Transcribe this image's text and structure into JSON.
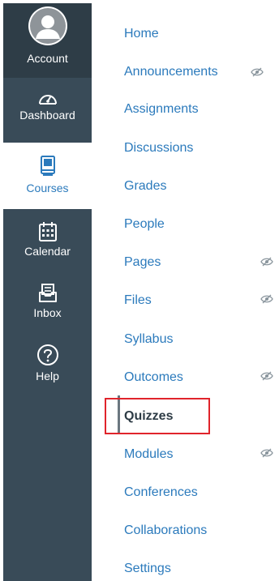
{
  "global_nav": {
    "account": {
      "label": "Account",
      "icon": "avatar-icon"
    },
    "dashboard": {
      "label": "Dashboard",
      "icon": "dashboard-gauge-icon"
    },
    "courses": {
      "label": "Courses",
      "icon": "courses-book-icon",
      "active": true
    },
    "calendar": {
      "label": "Calendar",
      "icon": "calendar-icon"
    },
    "inbox": {
      "label": "Inbox",
      "icon": "inbox-icon"
    },
    "help": {
      "label": "Help",
      "icon": "help-question-icon"
    }
  },
  "course_nav": {
    "items": [
      {
        "label": "Home",
        "hidden": false
      },
      {
        "label": "Announcements",
        "hidden": true
      },
      {
        "label": "Assignments",
        "hidden": false
      },
      {
        "label": "Discussions",
        "hidden": false
      },
      {
        "label": "Grades",
        "hidden": false
      },
      {
        "label": "People",
        "hidden": false
      },
      {
        "label": "Pages",
        "hidden": true
      },
      {
        "label": "Files",
        "hidden": true
      },
      {
        "label": "Syllabus",
        "hidden": false
      },
      {
        "label": "Outcomes",
        "hidden": true
      },
      {
        "label": "Quizzes",
        "hidden": false,
        "active": true,
        "highlighted": true
      },
      {
        "label": "Modules",
        "hidden": true
      },
      {
        "label": "Conferences",
        "hidden": false
      },
      {
        "label": "Collaborations",
        "hidden": false
      },
      {
        "label": "Settings",
        "hidden": false
      }
    ],
    "hidden_indicator_icon": "eye-slash-icon"
  },
  "colors": {
    "rail_background": "#394b58",
    "rail_account_background": "#2e3d47",
    "link": "#2b7abc",
    "active_text": "#2d3b45",
    "highlight_border": "#e0242b"
  }
}
